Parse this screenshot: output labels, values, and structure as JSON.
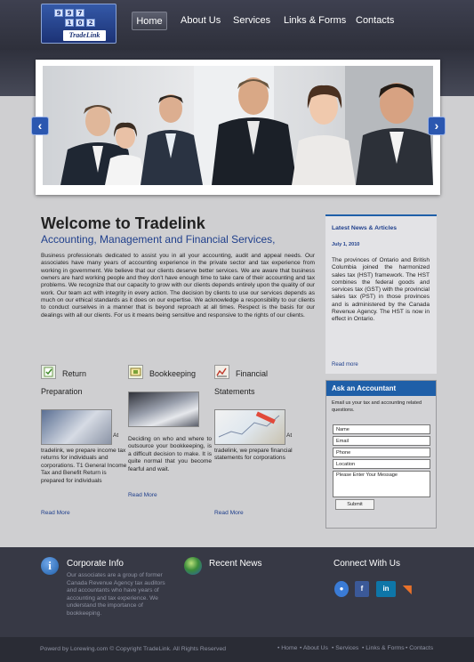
{
  "logo": {
    "tiles": [
      "9",
      "9",
      "7",
      "1",
      "0",
      "2"
    ],
    "name": "TradeLink"
  },
  "nav": [
    "Home",
    "About Us",
    "Services",
    "Links & Forms",
    "Contacts"
  ],
  "slider": {
    "prev": "‹",
    "next": "›"
  },
  "welcome": {
    "title": "Welcome to Tradelink",
    "subtitle": "Accounting, Management and Financial Services,",
    "body": "Business professionals dedicated to assist you in all your accounting, audit and appeal needs. Our associates have many years of accounting experience in the private sector and tax experience from working in government. We believe that our clients deserve better services. We are aware that business owners are hard working people and they don't have enough time to take care of their accounting and tax problems. We recognize that our capacity to grow with our clients depends entirely upon the quality of our work. Our team act with integrity in every action. The decision by clients to use our services depends as much on our ethical standards as it does on our expertise. We acknowledge a responsibility to our clients to conduct ourselves in a manner that is beyond reproach at all times. Respect is the basis for our dealings with all our clients. For us it means being sensitive and responsive to the rights of our clients."
  },
  "services": [
    {
      "title": "Return Preparation",
      "at": "At",
      "desc": "tradelink, we prepare income tax returns for individuals and corporations. T1 General Income Tax and Benefit Return is prepared for individuals",
      "more": "Read More"
    },
    {
      "title": "Bookkeeping",
      "at": "",
      "desc": "Deciding on who and where to outsource your bookkeeping, is a difficult decision to make. It is quite normal that you become fearful and wait.",
      "more": "Read More"
    },
    {
      "title": "Financial Statements",
      "at": "At",
      "desc": "tradelink, we prepare financial statements for corporations",
      "more": "Read More"
    }
  ],
  "news": {
    "title": "Latest News & Articles",
    "date": "July 1, 2010",
    "body": "The provinces of Ontario and British Columbia joined the harmonized sales tax (HST) framework. The HST combines the federal goods and services tax (GST) with the provincial sales tax (PST) in those provinces and is administered by the Canada Revenue Agency. The HST is now in effect in Ontario.",
    "more": "Read more"
  },
  "ask": {
    "title": "Ask an Accountant",
    "intro": "Email us your tax and accounting related questions.",
    "name": "Name",
    "email": "Email",
    "phone": "Phone",
    "location": "Location",
    "message": "Please Enter Your Message",
    "submit": "Submit"
  },
  "footer": {
    "corporate_title": "Corporate Info",
    "corporate_text": "Our associates are a group of former Canada Revenue Agency tax auditors and accountants who have years of accounting and tax experience. We understand the importance of bookkeeping.",
    "news_title": "Recent News",
    "connect_title": "Connect With Us",
    "social": [
      {
        "icon": "messenger-icon",
        "glyph": "●"
      },
      {
        "icon": "facebook-icon",
        "glyph": "f"
      },
      {
        "icon": "linkedin-icon",
        "glyph": "in"
      },
      {
        "icon": "rss-icon",
        "glyph": "◥"
      }
    ],
    "copyright": "Powerd by Lorewing.com © Copyright TradeLink. All Rights Reserved",
    "links": [
      "• Home",
      "• About Us",
      "• Services",
      "• Links & Forms",
      "• Contacts"
    ]
  },
  "colors": {
    "accent": "#1f5fa8",
    "link": "#1f3f8c",
    "header": "#353743",
    "footer": "#373945"
  }
}
